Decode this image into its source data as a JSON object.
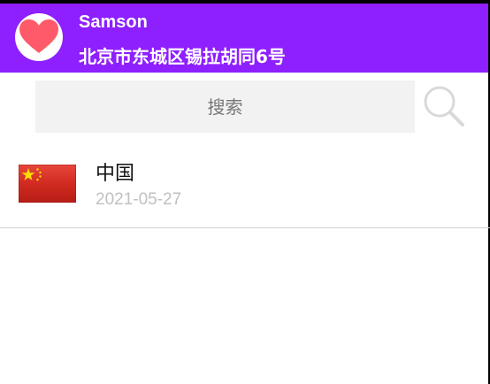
{
  "header": {
    "name": "Samson",
    "address": "北京市东城区锡拉胡同6号",
    "avatar_icon": "heart-icon",
    "background_color": "#8e1fff",
    "heart_color": "#ff5a6a"
  },
  "search": {
    "placeholder": "搜索",
    "button_icon": "search-icon"
  },
  "list": {
    "items": [
      {
        "title": "中国",
        "date": "2021-05-27",
        "icon": "china-flag-icon"
      }
    ]
  }
}
